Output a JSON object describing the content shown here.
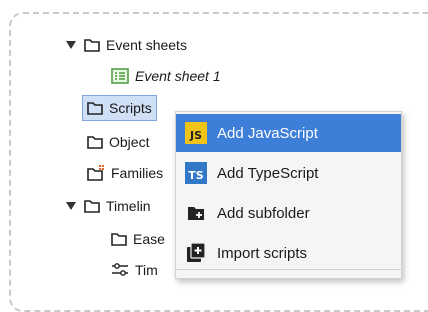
{
  "tree": {
    "items": [
      {
        "label": "Event sheets",
        "icon": "folder-icon",
        "expanded": true
      },
      {
        "label": "Event sheet 1",
        "icon": "event-sheet-icon"
      },
      {
        "label": "Scripts",
        "icon": "folder-icon",
        "selected": true
      },
      {
        "label": "Object",
        "icon": "folder-icon"
      },
      {
        "label": "Families",
        "icon": "families-folder-icon"
      },
      {
        "label": "Timelin",
        "icon": "folder-icon",
        "expanded": true
      },
      {
        "label": "Ease",
        "icon": "folder-icon"
      },
      {
        "label": "Tim",
        "icon": "timeline-icon"
      }
    ]
  },
  "context_menu": {
    "items": [
      {
        "label": "Add JavaScript",
        "icon": "javascript-icon",
        "icon_text": "JS"
      },
      {
        "label": "Add TypeScript",
        "icon": "typescript-icon",
        "icon_text": "TS"
      },
      {
        "label": "Add subfolder",
        "icon": "add-folder-icon"
      },
      {
        "label": "Import scripts",
        "icon": "import-icon"
      }
    ],
    "highlight_color": "#3d7ed8"
  },
  "colors": {
    "javascript": "#f0c419",
    "typescript": "#3178c6",
    "event_sheet": "#4a9a3a",
    "families_badge": "#e8622a"
  }
}
